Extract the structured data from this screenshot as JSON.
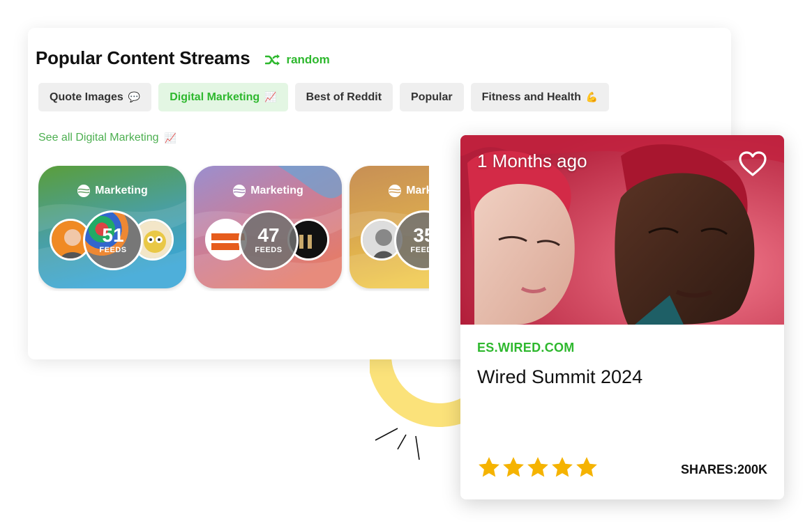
{
  "streams_panel": {
    "title": "Popular Content Streams",
    "random_label": "random",
    "tabs": [
      {
        "label": "Quote Images",
        "emoji": "💬"
      },
      {
        "label": "Digital Marketing",
        "emoji": "📈"
      },
      {
        "label": "Best of Reddit",
        "emoji": ""
      },
      {
        "label": "Popular",
        "emoji": ""
      },
      {
        "label": "Fitness and Health",
        "emoji": "💪"
      }
    ],
    "active_tab": "Digital Marketing",
    "see_all_label": "See all Digital Marketing",
    "see_all_emoji": "📈",
    "streams": [
      {
        "label": "Marketing",
        "count": "51",
        "feeds_label": "FEEDS"
      },
      {
        "label": "Marketing",
        "count": "47",
        "feeds_label": "FEEDS"
      },
      {
        "label": "Marketing",
        "count": "35",
        "feeds_label": "FEEDS"
      }
    ]
  },
  "article_card": {
    "time_ago": "1 Months ago",
    "source": "ES.WIRED.COM",
    "headline": "Wired Summit 2024",
    "rating": 5,
    "rating_max": 5,
    "shares": "SHARES:200K"
  },
  "colors": {
    "accent_green": "#2eb82e",
    "star": "#f5b301",
    "sun": "#fbe27a"
  }
}
